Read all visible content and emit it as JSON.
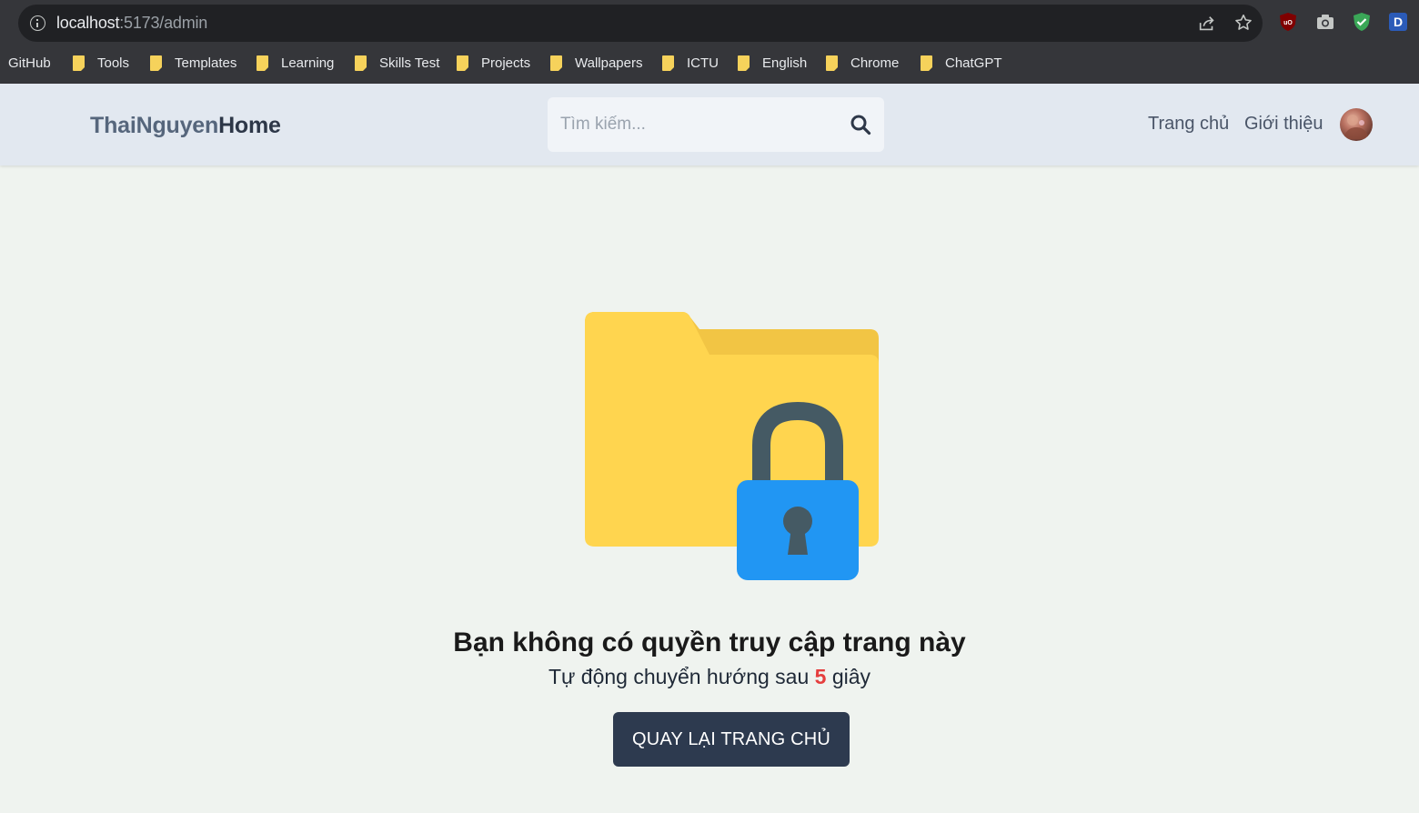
{
  "browser": {
    "url_host": "localhost",
    "url_rest": ":5173/admin",
    "bookmarks": [
      {
        "label": "GitHub",
        "folder": false
      },
      {
        "label": "Tools",
        "folder": true
      },
      {
        "label": "Templates",
        "folder": true
      },
      {
        "label": "Learning",
        "folder": true
      },
      {
        "label": "Skills Test",
        "folder": true
      },
      {
        "label": "Projects",
        "folder": true
      },
      {
        "label": "Wallpapers",
        "folder": true
      },
      {
        "label": "ICTU",
        "folder": true
      },
      {
        "label": "English",
        "folder": true
      },
      {
        "label": "Chrome",
        "folder": true
      },
      {
        "label": "ChatGPT",
        "folder": true
      }
    ],
    "extensions": [
      "ublock-origin-icon",
      "camera-icon",
      "shield-check-icon",
      "d-extension-icon"
    ],
    "extension_d_label": "D",
    "extension_ublock_label": "uO"
  },
  "header": {
    "logo_part1": "ThaiNguyen",
    "logo_part2": "Home",
    "search_placeholder": "Tìm kiếm...",
    "nav": [
      {
        "label": "Trang chủ"
      },
      {
        "label": "Giới thiệu"
      }
    ]
  },
  "main": {
    "illustration": "locked-folder-icon",
    "title": "Bạn không có quyền truy cập trang này",
    "redirect_prefix": "Tự động chuyển hướng sau",
    "redirect_seconds": "5",
    "redirect_suffix": "giây",
    "back_button": "QUAY LẠI TRANG CHỦ"
  },
  "colors": {
    "folder": "#ffd54f",
    "folder_back": "#f2c544",
    "lock_body": "#2196f3",
    "lock_shackle": "#455a64",
    "button": "#2d3a4f",
    "countdown": "#e53e3e"
  }
}
